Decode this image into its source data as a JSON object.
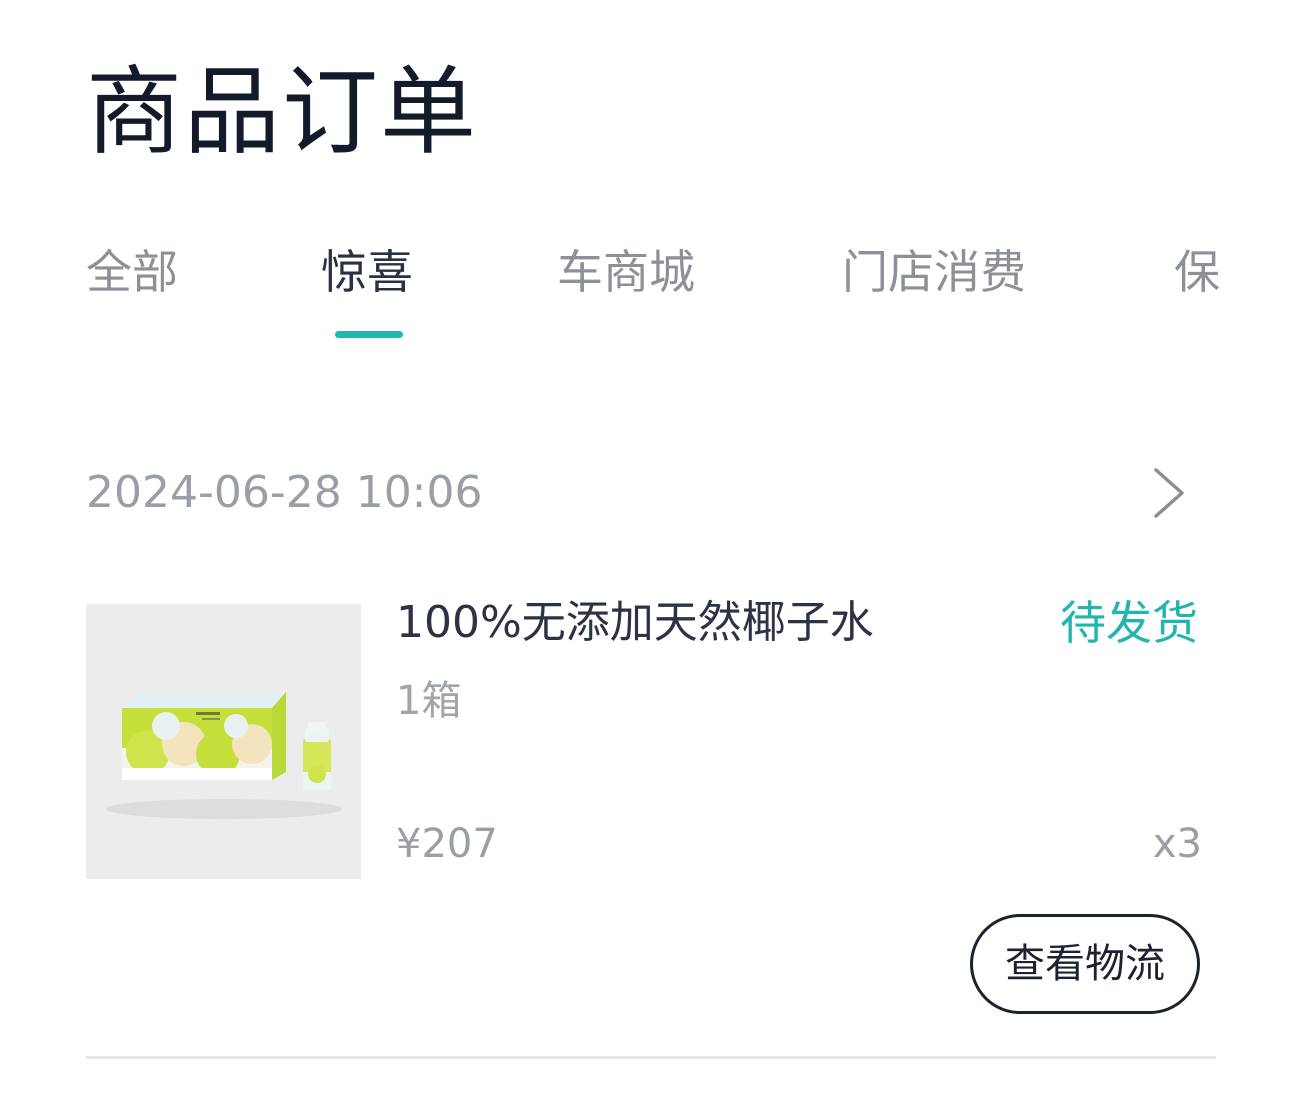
{
  "header": {
    "title": "商品订单"
  },
  "tabs": [
    {
      "label": "全部",
      "active": false
    },
    {
      "label": "惊喜",
      "active": true
    },
    {
      "label": "车商城",
      "active": false
    },
    {
      "label": "门店消费",
      "active": false
    },
    {
      "label": "保",
      "active": false
    }
  ],
  "colors": {
    "accent": "#1fb8b0",
    "status": "#22b5ad",
    "title": "#131a2a",
    "muted": "#9a9ea6"
  },
  "order": {
    "time": "2024-06-28 10:06",
    "chevron_icon": "chevron-right-icon",
    "product": {
      "name": "100%无添加天然椰子水",
      "spec": "1箱",
      "price": "¥207",
      "quantity": "x3",
      "image_icon": "product-coconut-water-image"
    },
    "status": "待发货",
    "actions": {
      "logistics_label": "查看物流"
    }
  }
}
